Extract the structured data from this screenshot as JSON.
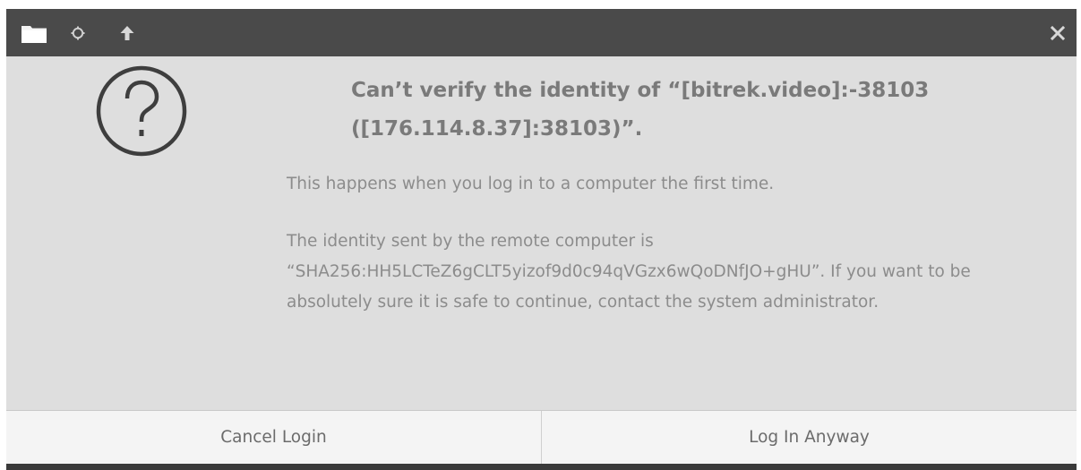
{
  "titlebar": {
    "icons": [
      "folder-icon",
      "gear-icon",
      "up-arrow-icon",
      "close-icon"
    ],
    "background_color": "#4a4a4a"
  },
  "dialog": {
    "icon": "question-icon",
    "heading": "Can’t verify the identity of “[bitrek.video]:-38103 ([176.114.8.37]:38103)”.",
    "paragraph_1": "This happens when you log in to a computer the first time.",
    "paragraph_2": "The identity sent by the remote computer is “SHA256:HH5LCTeZ6gCLT5yizof9d0c94qVGzx6wQoDNfJO+gHU”. If you want to be absolutely sure it is safe to continue, contact the system administrator."
  },
  "buttons": {
    "cancel_label": "Cancel Login",
    "confirm_label": "Log In Anyway"
  }
}
